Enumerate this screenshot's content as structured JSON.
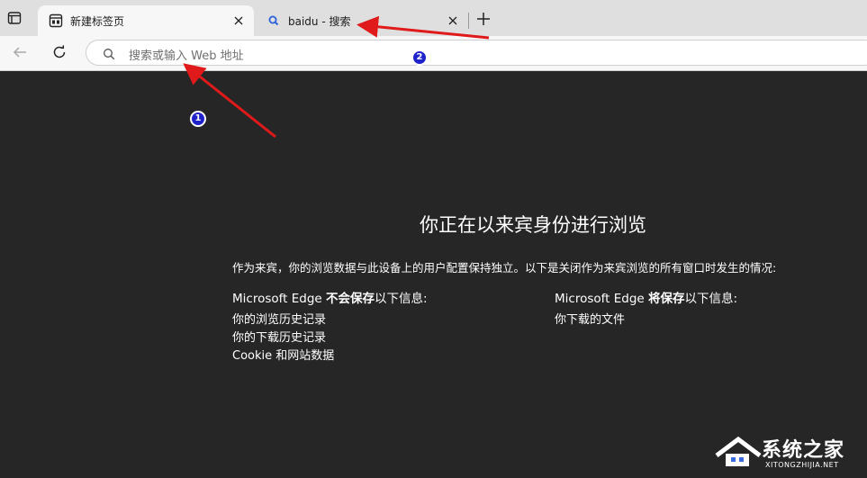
{
  "tabs": [
    {
      "title": "新建标签页",
      "favicon": "new-tab-page-icon",
      "active": true
    },
    {
      "title": "baidu - 搜索",
      "favicon": "search-icon",
      "active": false
    }
  ],
  "toolbar": {
    "address_placeholder": "搜索或输入 Web 地址"
  },
  "page": {
    "heading": "你正在以来宾身份进行浏览",
    "intro": "作为来宾，你的浏览数据与此设备上的用户配置保持独立。以下是关闭作为来宾浏览的所有窗口时发生的情况:",
    "left_col": {
      "prefix": "Microsoft Edge ",
      "bold": "不会保存",
      "suffix": "以下信息:",
      "items": [
        "你的浏览历史记录",
        "你的下载历史记录",
        "Cookie 和网站数据"
      ]
    },
    "right_col": {
      "prefix": "Microsoft Edge ",
      "bold": "将保存",
      "suffix": "以下信息:",
      "items": [
        "你下载的文件"
      ]
    }
  },
  "annotations": {
    "marker_1": "1",
    "marker_2": "2",
    "arrow_color": "#e01a1a"
  },
  "watermark": {
    "text_cn": "系统之家",
    "text_en": "XITONGZHIJIA.NET"
  },
  "colors": {
    "tabstrip": "#dfdfdf",
    "toolbar": "#f7f7f7",
    "content_bg": "#262626",
    "marker_blue": "#1e22c8"
  }
}
